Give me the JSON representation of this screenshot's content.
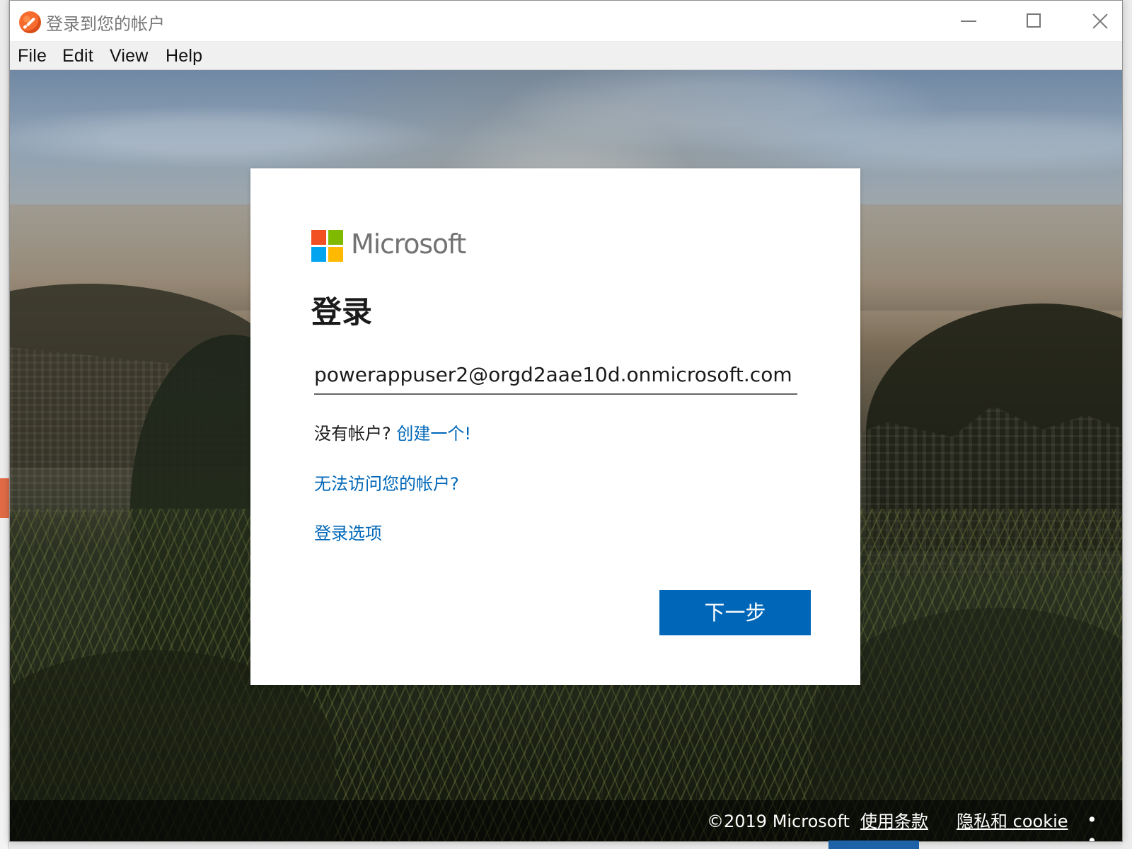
{
  "window": {
    "title": "登录到您的帐户",
    "app_icon": "orange-pen-circle-icon"
  },
  "menu": {
    "items": [
      "File",
      "Edit",
      "View",
      "Help"
    ]
  },
  "signin": {
    "brand": "Microsoft",
    "heading": "登录",
    "email_value": "powerappuser2@orgd2aae10d.onmicrosoft.com",
    "no_account_text": "没有帐户?",
    "create_account_link": "创建一个!",
    "cannot_access_link": "无法访问您的帐户?",
    "signin_options_link": "登录选项",
    "next_button": "下一步"
  },
  "footer": {
    "copyright": "©2019 Microsoft",
    "terms": "使用条款",
    "privacy": "隐私和 cookie",
    "more": "• • •"
  },
  "colors": {
    "microsoft_blue": "#0067b8",
    "logo_red": "#f25022",
    "logo_green": "#7fba00",
    "logo_blue": "#00a4ef",
    "logo_yellow": "#ffb900"
  }
}
